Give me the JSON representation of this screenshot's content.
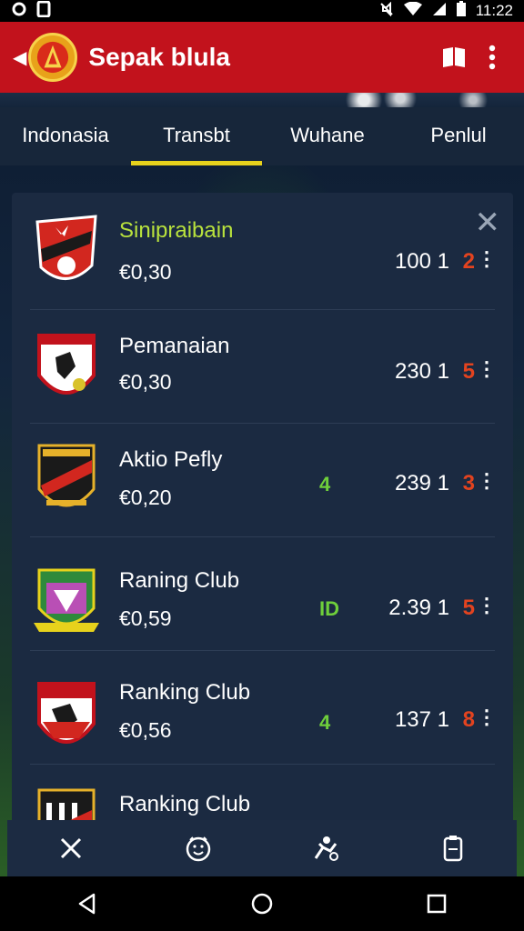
{
  "status_bar": {
    "left_icons": [
      "location-icon",
      "sim-icon"
    ],
    "right_icons": [
      "mute-icon",
      "wifi-icon",
      "signal-icon",
      "battery-icon"
    ],
    "time": "11:22"
  },
  "app_bar": {
    "title": "Sepak blula",
    "actions": [
      "flag-icon",
      "more-vert-icon"
    ]
  },
  "tabs": [
    {
      "label": "Indonasia",
      "active": false
    },
    {
      "label": "Transbt",
      "active": true
    },
    {
      "label": "Wuhane",
      "active": false
    },
    {
      "label": "Penlul",
      "active": false
    }
  ],
  "clubs": [
    {
      "name": "Sinipraibain",
      "odds": "€0,30",
      "trend": "",
      "score": "100 1",
      "score_red": "2",
      "highlight": true
    },
    {
      "name": "Pemanaian",
      "odds": "€0,30",
      "trend": "",
      "score": "230 1",
      "score_red": "5",
      "highlight": false
    },
    {
      "name": "Aktio Pefly",
      "odds": "€0,20",
      "trend": "4",
      "score": "239 1",
      "score_red": "3",
      "highlight": false
    },
    {
      "name": "Raning Club",
      "odds": "€0,59",
      "trend": "ID",
      "score": "2.39 1",
      "score_red": "5",
      "highlight": false
    },
    {
      "name": "Ranking Club",
      "odds": "€0,56",
      "trend": "4",
      "score": "137 1",
      "score_red": "8",
      "highlight": false
    },
    {
      "name": "Ranking Club",
      "odds": "",
      "trend": "",
      "score": "",
      "score_red": "",
      "highlight": false
    }
  ],
  "bottom_bar": [
    "close-icon",
    "smile-icon",
    "player-icon",
    "clipboard-icon"
  ],
  "system_nav": [
    "back-icon",
    "home-icon",
    "recents-icon"
  ],
  "colors": {
    "app_bar": "#c2121c",
    "tab_indicator": "#e7d21c",
    "card_bg": "#1b2a41",
    "highlight_text": "#b9e23d",
    "score_red": "#e3431f",
    "trend_green": "#6fcf3b"
  }
}
